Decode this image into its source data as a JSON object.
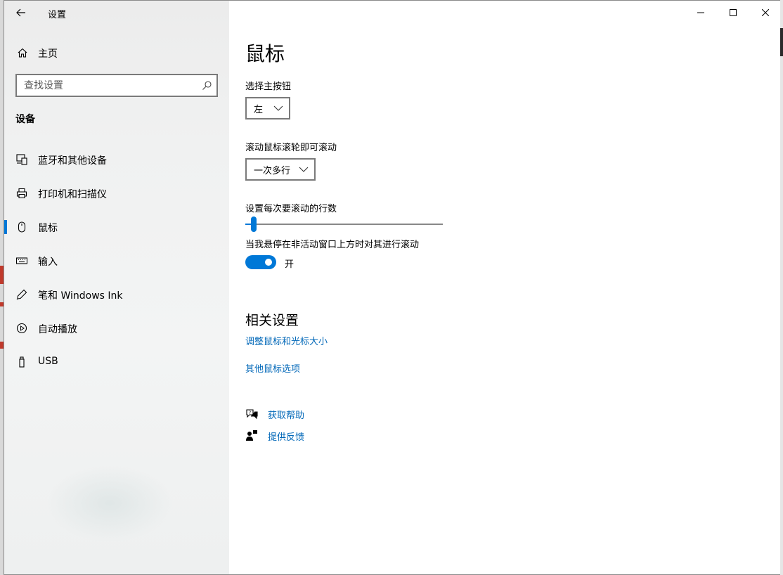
{
  "window": {
    "app_title": "设置",
    "accent_color": "#0078d7",
    "link_color": "#0067b8"
  },
  "sidebar": {
    "home_label": "主页",
    "search_placeholder": "查找设置",
    "section_title": "设备",
    "items": [
      {
        "label": "蓝牙和其他设备",
        "icon": "bluetooth-devices-icon",
        "active": false
      },
      {
        "label": "打印机和扫描仪",
        "icon": "printer-icon",
        "active": false
      },
      {
        "label": "鼠标",
        "icon": "mouse-icon",
        "active": true
      },
      {
        "label": "输入",
        "icon": "keyboard-icon",
        "active": false
      },
      {
        "label": "笔和 Windows Ink",
        "icon": "pen-icon",
        "active": false
      },
      {
        "label": "自动播放",
        "icon": "autoplay-icon",
        "active": false
      },
      {
        "label": "USB",
        "icon": "usb-icon",
        "active": false
      }
    ]
  },
  "main": {
    "page_title": "鼠标",
    "primary_button": {
      "label": "选择主按钮",
      "value": "左"
    },
    "wheel_scroll": {
      "label": "滚动鼠标滚轮即可滚动",
      "value": "一次多行"
    },
    "scroll_lines": {
      "label": "设置每次要滚动的行数",
      "slider_fraction": 0.03
    },
    "inactive_scroll": {
      "label": "当我悬停在非活动窗口上方时对其进行滚动",
      "state": "开",
      "on": true
    },
    "related": {
      "title": "相关设置",
      "links": [
        "调整鼠标和光标大小",
        "其他鼠标选项"
      ]
    },
    "help": {
      "get_help": "获取帮助",
      "feedback": "提供反馈"
    }
  }
}
